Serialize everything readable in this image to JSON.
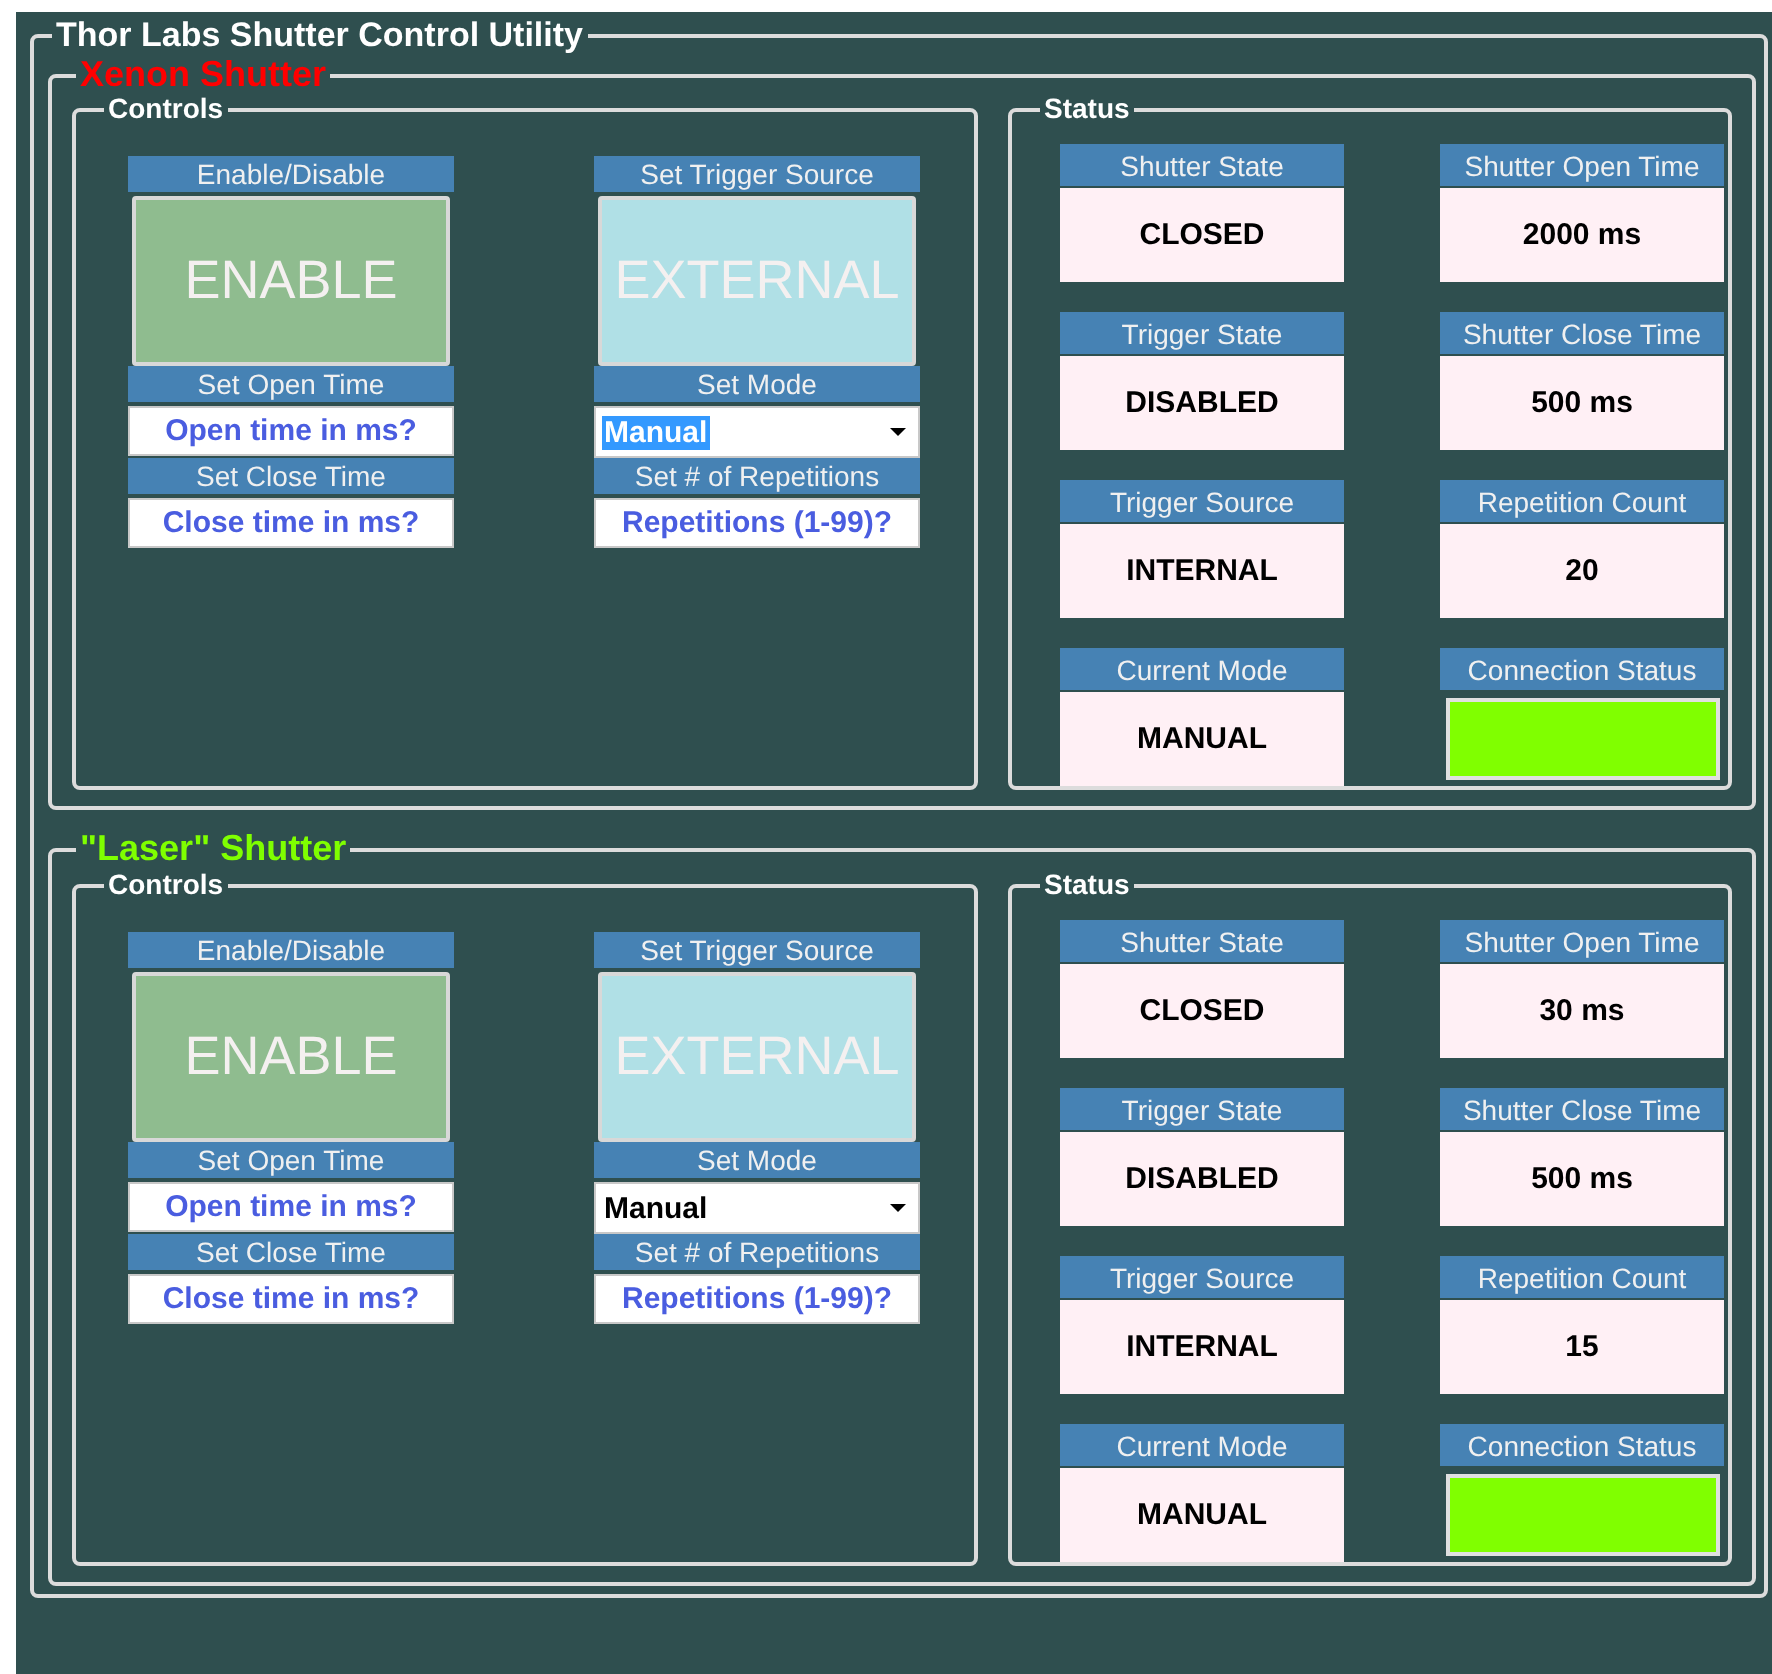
{
  "window": {
    "title": "Thor Labs Shutter Control Utility"
  },
  "shutters": [
    {
      "title": "Xenon Shutter",
      "color": "#ff0000",
      "controls": {
        "legend": "Controls",
        "enable": {
          "label": "Enable/Disable",
          "button": "ENABLE"
        },
        "trigger_source": {
          "label": "Set Trigger Source",
          "button": "EXTERNAL"
        },
        "open_time": {
          "label": "Set Open Time",
          "placeholder": "Open time in ms?"
        },
        "mode": {
          "label": "Set Mode",
          "value": "Manual",
          "text_selected": true
        },
        "close_time": {
          "label": "Set Close Time",
          "placeholder": "Close time in ms?"
        },
        "repetitions": {
          "label": "Set # of Repetitions",
          "placeholder": "Repetitions (1-99)?"
        }
      },
      "status": {
        "legend": "Status",
        "tiles": [
          {
            "kind": "text",
            "label": "Shutter State",
            "value": "CLOSED"
          },
          {
            "kind": "text",
            "label": "Shutter Open Time",
            "value": "2000 ms"
          },
          {
            "kind": "text",
            "label": "Trigger State",
            "value": "DISABLED"
          },
          {
            "kind": "text",
            "label": "Shutter Close Time",
            "value": "500 ms"
          },
          {
            "kind": "text",
            "label": "Trigger Source",
            "value": "INTERNAL"
          },
          {
            "kind": "text",
            "label": "Repetition Count",
            "value": "20"
          },
          {
            "kind": "text",
            "label": "Current Mode",
            "value": "MANUAL"
          },
          {
            "kind": "indicator",
            "label": "Connection Status",
            "color": "#80ff00"
          }
        ]
      }
    },
    {
      "title": "\"Laser\" Shutter",
      "color": "#7fff00",
      "controls": {
        "legend": "Controls",
        "enable": {
          "label": "Enable/Disable",
          "button": "ENABLE"
        },
        "trigger_source": {
          "label": "Set Trigger Source",
          "button": "EXTERNAL"
        },
        "open_time": {
          "label": "Set Open Time",
          "placeholder": "Open time in ms?"
        },
        "mode": {
          "label": "Set Mode",
          "value": "Manual",
          "text_selected": false
        },
        "close_time": {
          "label": "Set Close Time",
          "placeholder": "Close time in ms?"
        },
        "repetitions": {
          "label": "Set # of Repetitions",
          "placeholder": "Repetitions (1-99)?"
        }
      },
      "status": {
        "legend": "Status",
        "tiles": [
          {
            "kind": "text",
            "label": "Shutter State",
            "value": "CLOSED"
          },
          {
            "kind": "text",
            "label": "Shutter Open Time",
            "value": "30 ms"
          },
          {
            "kind": "text",
            "label": "Trigger State",
            "value": "DISABLED"
          },
          {
            "kind": "text",
            "label": "Shutter Close Time",
            "value": "500 ms"
          },
          {
            "kind": "text",
            "label": "Trigger Source",
            "value": "INTERNAL"
          },
          {
            "kind": "text",
            "label": "Repetition Count",
            "value": "15"
          },
          {
            "kind": "text",
            "label": "Current Mode",
            "value": "MANUAL"
          },
          {
            "kind": "indicator",
            "label": "Connection Status",
            "color": "#80ff00"
          }
        ]
      }
    }
  ]
}
